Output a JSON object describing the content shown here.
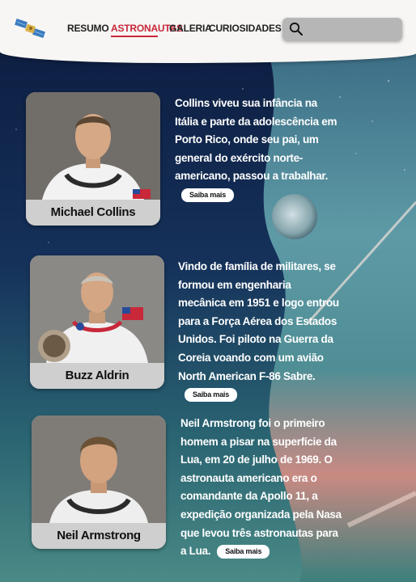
{
  "nav": {
    "items": [
      {
        "label": "RESUMO"
      },
      {
        "label": "ASTRONAUTAS"
      },
      {
        "label": "GALERIA"
      },
      {
        "label": "CURIOSIDADES"
      }
    ],
    "active_index": 1
  },
  "search": {
    "placeholder": ""
  },
  "colors": {
    "accent": "#c8283a",
    "card": "#cfcfcf",
    "header": "#f7f6f4"
  },
  "astronauts": [
    {
      "name": "Michael Collins",
      "bio": "Collins viveu sua infância na Itália e parte da adolescência em Porto Rico, onde seu pai, um general do exército norte-americano, passou a trabalhar.",
      "more_label": "Saiba mais"
    },
    {
      "name": "Buzz Aldrin",
      "bio": "Vindo de família de militares, se formou em engenharia mecânica em 1951 e logo entrou para a Força Aérea dos Estados Unidos. Foi piloto na Guerra da Coreia voando com um avião North American F-86 Sabre.",
      "more_label": "Saiba mais"
    },
    {
      "name": "Neil Armstrong",
      "bio": "Neil Armstrong foi o primeiro homem a pisar na superfície da Lua, em 20 de julho de 1969. O astronauta americano era o comandante da Apollo 11, a expedição organizada pela Nasa que levou três astronautas para a Lua.",
      "more_label": "Saiba mais"
    }
  ]
}
